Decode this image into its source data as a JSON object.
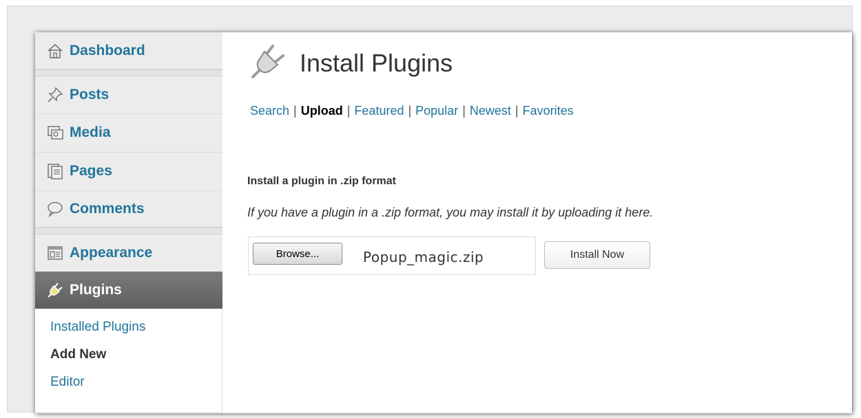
{
  "sidebar": {
    "items": [
      {
        "label": "Dashboard",
        "icon": "dashboard-icon"
      },
      {
        "label": "Posts",
        "icon": "pin-icon"
      },
      {
        "label": "Media",
        "icon": "media-icon"
      },
      {
        "label": "Pages",
        "icon": "pages-icon"
      },
      {
        "label": "Comments",
        "icon": "comment-icon"
      },
      {
        "label": "Appearance",
        "icon": "appearance-icon"
      },
      {
        "label": "Plugins",
        "icon": "plug-icon"
      }
    ],
    "submenu": [
      {
        "label": "Installed Plugins"
      },
      {
        "label": "Add New"
      },
      {
        "label": "Editor"
      }
    ]
  },
  "main": {
    "title": "Install Plugins",
    "tabs": [
      {
        "label": "Search"
      },
      {
        "label": "Upload"
      },
      {
        "label": "Featured"
      },
      {
        "label": "Popular"
      },
      {
        "label": "Newest"
      },
      {
        "label": "Favorites"
      }
    ],
    "separator": "|",
    "heading": "Install a plugin in .zip format",
    "description": "If you have a plugin in a .zip format, you may install it by uploading it here.",
    "upload": {
      "browse_label": "Browse...",
      "file_name": "Popup_magic.zip",
      "install_label": "Install Now"
    }
  },
  "colors": {
    "link": "#21759b",
    "sidebar_bg": "#ececec",
    "active_bg": "#666666"
  }
}
